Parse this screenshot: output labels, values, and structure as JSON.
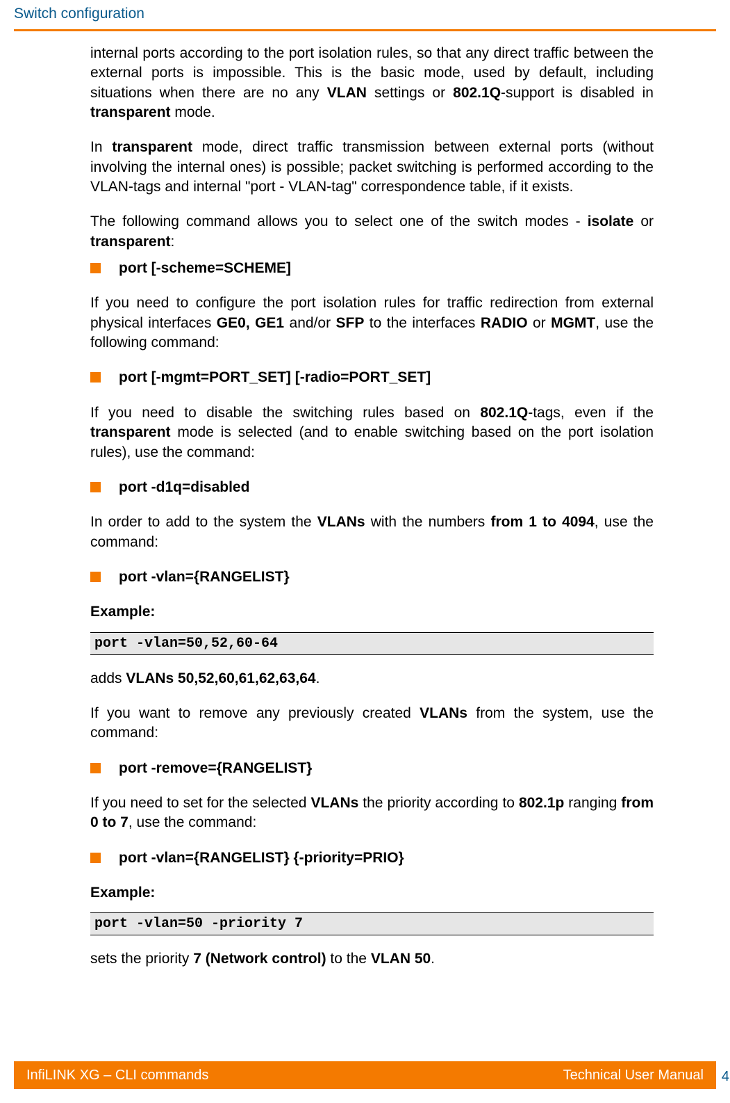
{
  "header": {
    "title": "Switch configuration"
  },
  "paragraphs": {
    "p1_pre": "internal ports according to the port isolation rules, so that any direct traffic between the external ports is impossible. This is the basic mode, used by default, including situations when there are no any ",
    "p1_b1": "VLAN",
    "p1_mid1": " settings or ",
    "p1_b2": "802.1Q",
    "p1_mid2": "-support is disabled in ",
    "p1_b3": "transparent",
    "p1_post": " mode.",
    "p2_pre": "In ",
    "p2_b1": "transparent",
    "p2_post": " mode, direct traffic transmission between external ports (without involving the internal ones) is possible; packet switching is performed according to the VLAN-tags and internal \"port - VLAN-tag\" correspondence table, if it exists.",
    "p3_pre": "The following command allows you to select one of the switch modes - ",
    "p3_b1": "isolate",
    "p3_mid": " or ",
    "p3_b2": "transparent",
    "p3_post": ":",
    "bullet1": "port [-scheme=SCHEME]",
    "p4_pre": "If you need to configure the port isolation rules for traffic redirection from external physical interfaces ",
    "p4_b1": "GE0, GE1",
    "p4_mid1": " and/or ",
    "p4_b2": "SFP",
    "p4_mid2": " to the interfaces ",
    "p4_b3": "RADIO",
    "p4_mid3": " or ",
    "p4_b4": "MGMT",
    "p4_post": ", use the following command:",
    "bullet2": "port [-mgmt=PORT_SET] [-radio=PORT_SET]",
    "p5_pre": "If you need to disable the switching rules based on ",
    "p5_b1": "802.1Q",
    "p5_mid1": "-tags, even if the ",
    "p5_b2": "transparent",
    "p5_post": " mode is selected (and to enable switching based on the port isolation rules), use the command:",
    "bullet3": "port -d1q=disabled",
    "p6_pre": "In order to add to the system the ",
    "p6_b1": "VLANs",
    "p6_mid": " with the numbers ",
    "p6_b2": "from 1 to 4094",
    "p6_post": ", use the command:",
    "bullet4": "port -vlan={RANGELIST}",
    "example1_label": "Example:",
    "code1": "port -vlan=50,52,60-64",
    "p7_pre": "adds ",
    "p7_b1": "VLANs 50,52,60,61,62,63,64",
    "p7_post": ".",
    "p8_pre": "If you want to remove any previously created ",
    "p8_b1": "VLANs",
    "p8_post": " from the system, use the command:",
    "bullet5": "port -remove={RANGELIST}",
    "p9_pre": "If you need to set for the selected ",
    "p9_b1": "VLANs",
    "p9_mid1": " the priority according to ",
    "p9_b2": "802.1p",
    "p9_mid2": " ranging ",
    "p9_b3": "from 0 to 7",
    "p9_post": ", use the command:",
    "bullet6": "port -vlan={RANGELIST} {-priority=PRIO}",
    "example2_label": "Example:",
    "code2": "port -vlan=50 -priority 7",
    "p10_pre": "sets the priority ",
    "p10_b1": "7 (Network control)",
    "p10_mid": " to the ",
    "p10_b2": "VLAN 50",
    "p10_post": "."
  },
  "footer": {
    "left": "InfiLINK XG – CLI commands",
    "right": "Technical User Manual",
    "page": "4"
  }
}
